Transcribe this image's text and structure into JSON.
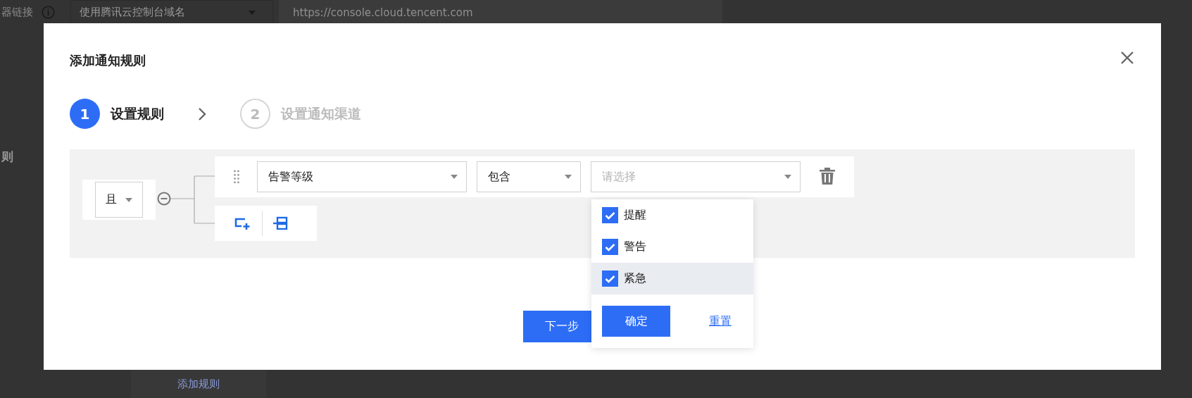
{
  "background_page": {
    "field_label": "器链接",
    "domain_select": {
      "value": "使用腾讯云控制台域名"
    },
    "url_field": {
      "value": "https://console.cloud.tencent.com"
    },
    "section_label": "则",
    "add_rule_link": "添加规则"
  },
  "dialog": {
    "title": "添加通知规则",
    "steps": [
      {
        "number": "1",
        "label": "设置规则",
        "selected": true
      },
      {
        "number": "2",
        "label": "设置通知渠道",
        "selected": false
      }
    ],
    "rule_group": {
      "logic_select": {
        "value": "且"
      },
      "conditions": [
        {
          "field": {
            "value": "告警等级"
          },
          "operator": {
            "value": "包含"
          },
          "values": {
            "placeholder": "请选择",
            "expanded": true,
            "options": [
              {
                "label": "提醒",
                "checked": true,
                "selected": false
              },
              {
                "label": "警告",
                "checked": true,
                "selected": false
              },
              {
                "label": "紧急",
                "checked": true,
                "selected": true
              }
            ],
            "buttons": [
              {
                "label": "确定",
                "kind": "primary"
              },
              {
                "label": "重置",
                "kind": "link"
              }
            ]
          }
        }
      ]
    },
    "next_button": "下一步"
  }
}
